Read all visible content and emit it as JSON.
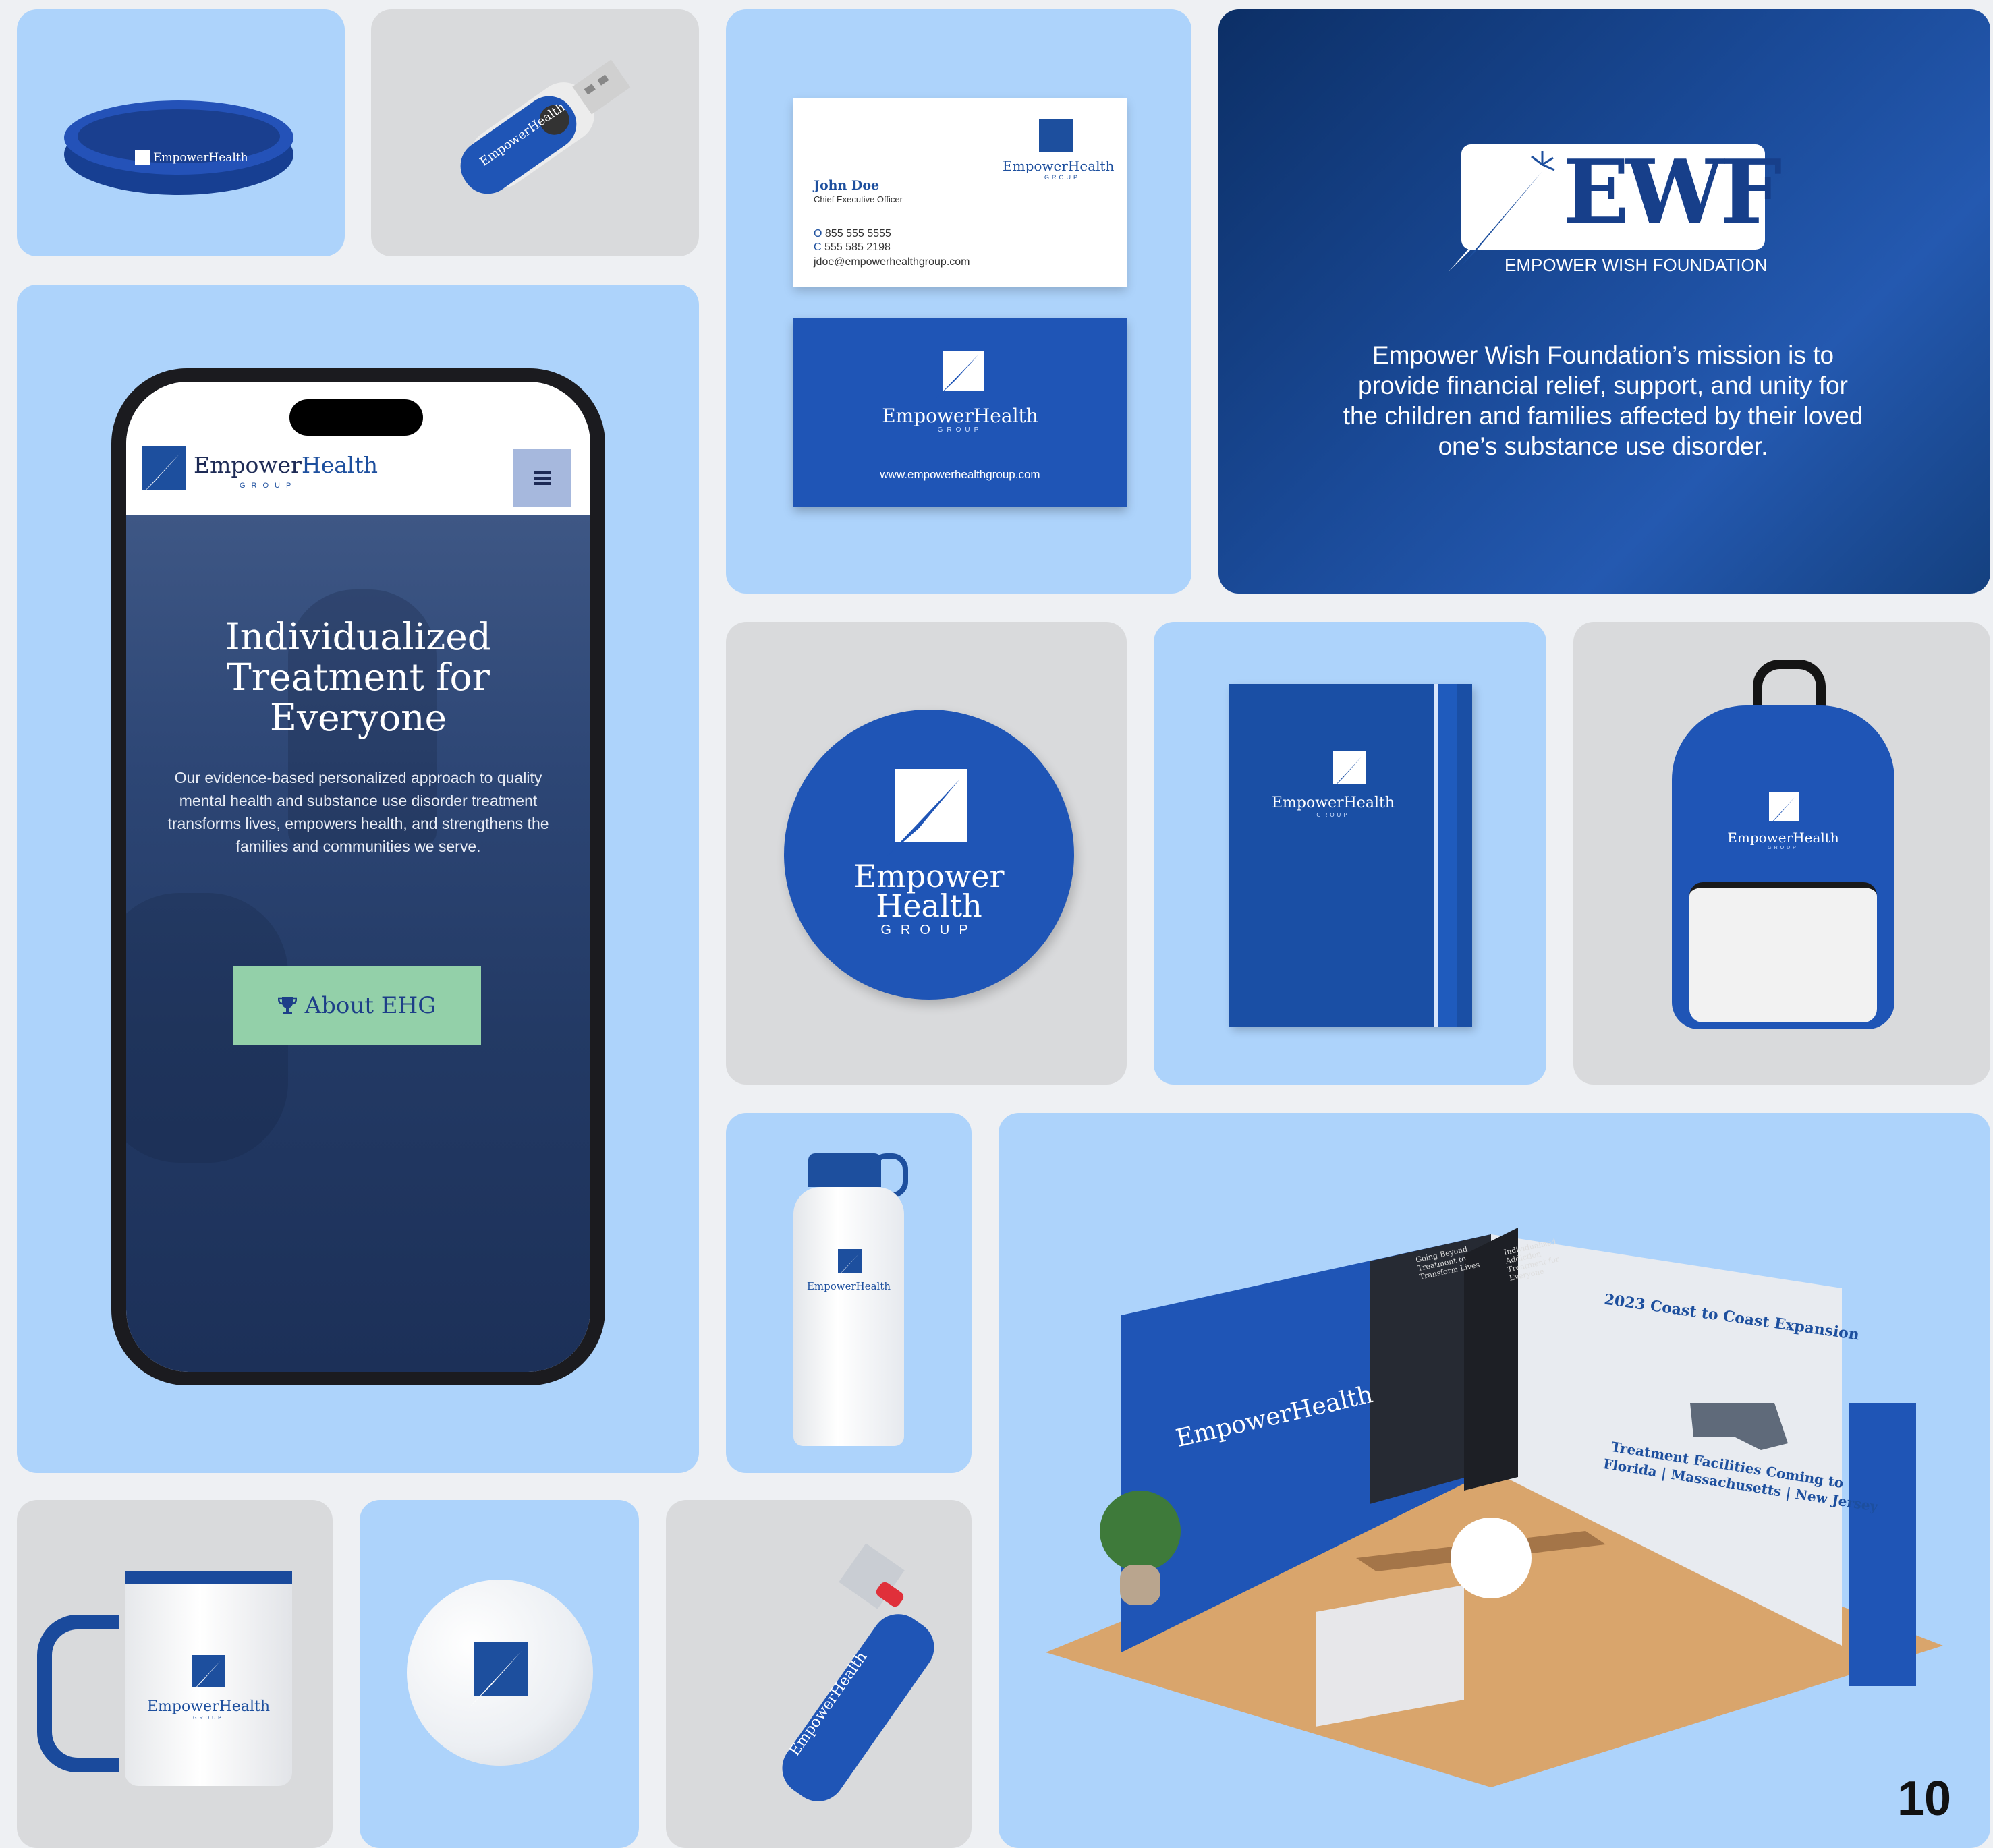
{
  "brand": {
    "name_primary": "Empower",
    "name_secondary": "Health",
    "group": "GROUP",
    "full_name": "EmpowerHealth",
    "colors": {
      "brand_blue": "#1d52b1",
      "navy": "#0c2f66",
      "light_blue": "#add3fb",
      "gray_tile": "#d9dadc",
      "cta_green": "#93d0a9"
    }
  },
  "phone": {
    "menu_icon": "hamburger-icon",
    "hero_title": "Individualized Treatment for Everyone",
    "hero_body": "Our evidence-based personalized approach to quality mental health and substance use disorder treatment transforms lives, empowers health, and strengthens the families and communities we serve.",
    "cta_icon": "trophy-icon",
    "cta_label": "About EHG"
  },
  "business_card": {
    "name": "John Doe",
    "title": "Chief Executive Officer",
    "office_prefix": "O",
    "office": "855 555 5555",
    "cell_prefix": "C",
    "cell": "555 585 2198",
    "email": "jdoe@empowerhealthgroup.com",
    "website": "www.empowerhealthgroup.com"
  },
  "ewf": {
    "acronym": "EWF",
    "name": "EMPOWER WISH FOUNDATION",
    "mission": "Empower Wish Foundation’s mission is to provide financial relief, support, and unity for the children and families affected by their loved one’s substance use disorder."
  },
  "sticker": {
    "line1": "Empower",
    "line2": "Health",
    "line3": "GROUP"
  },
  "booth": {
    "panel_left": "Going Beyond Treatment to Transform Lives",
    "panel_right": "Individualized Addiction Treatment for Everyone",
    "expansion_title": "2023 Coast to Coast Expansion",
    "facilities_line1": "Treatment Facilities Coming to",
    "facilities_line2": "Florida | Massachusetts | New Jersey",
    "wall_brand": "EmpowerHealth"
  },
  "page_number": "10"
}
